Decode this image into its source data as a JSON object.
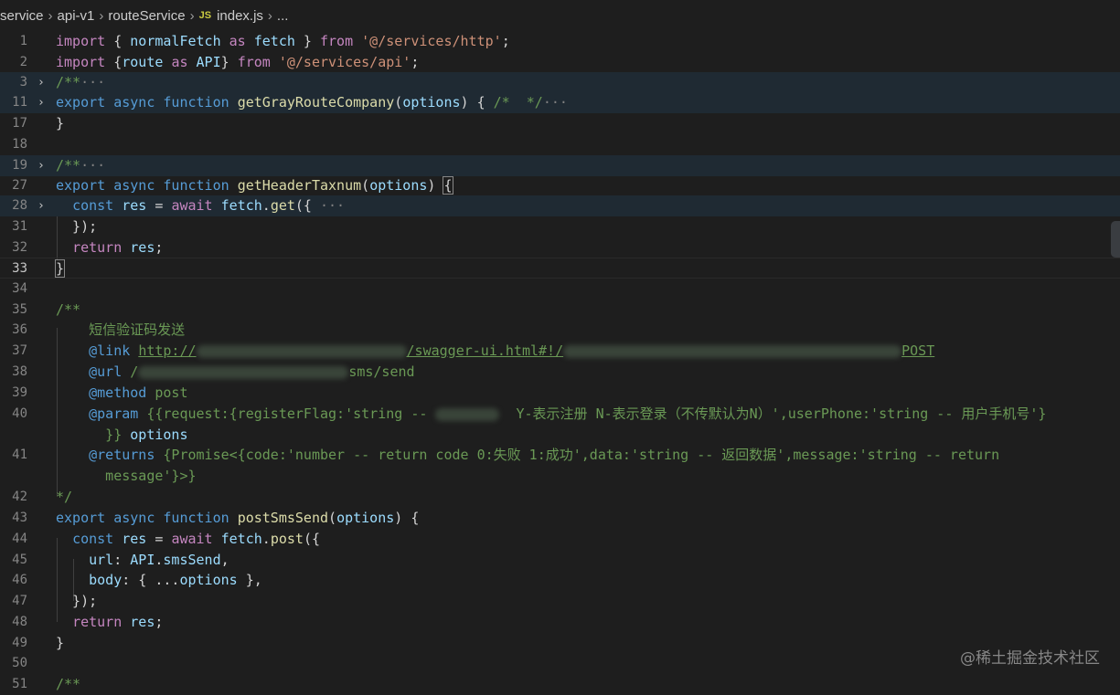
{
  "breadcrumb": {
    "items": [
      "service",
      "api-v1",
      "routeService"
    ],
    "js_badge": "JS",
    "file": "index.js",
    "more": "..."
  },
  "lines": {
    "l1": {
      "num": "1",
      "text": "import { normalFetch as fetch } from '@/services/http';"
    },
    "l2": {
      "num": "2",
      "text": "import {route as API} from '@/services/api';"
    },
    "l3": {
      "num": "3",
      "text": "/**···"
    },
    "l11": {
      "num": "11",
      "text": "export async function getGrayRouteCompany(options) { /*  */···"
    },
    "l17": {
      "num": "17",
      "text": "}"
    },
    "l18": {
      "num": "18",
      "text": ""
    },
    "l19": {
      "num": "19",
      "text": "/**···"
    },
    "l27": {
      "num": "27",
      "text": "export async function getHeaderTaxnum(options) {"
    },
    "l28": {
      "num": "28",
      "text": "const res = await fetch.get({ ···"
    },
    "l31": {
      "num": "31",
      "text": "});"
    },
    "l32": {
      "num": "32",
      "text": "return res;"
    },
    "l33": {
      "num": "33",
      "text": "}"
    },
    "l34": {
      "num": "34",
      "text": ""
    },
    "l35": {
      "num": "35",
      "text": "/**"
    },
    "l36": {
      "num": "36",
      "text": "短信验证码发送"
    },
    "l37": {
      "num": "37",
      "text": "@link http://"
    },
    "l38": {
      "num": "38",
      "text": "@url /"
    },
    "l39": {
      "num": "39",
      "text": "@method post"
    },
    "l40": {
      "num": "40",
      "text": "@param {{request:{registerFlag:'string -- Y-表示注册 N-表示登录（不传默认为N）',userPhone:'string -- 用户手机号'}}} options"
    },
    "l41": {
      "num": "41",
      "text": "@returns {Promise<{code:'number -- return code 0:失败 1:成功',data:'string -- 返回数据',message:'string -- return message'}>}"
    },
    "l42": {
      "num": "42",
      "text": "*/"
    },
    "l43": {
      "num": "43",
      "text": "export async function postSmsSend(options) {"
    },
    "l44": {
      "num": "44",
      "text": "const res = await fetch.post({"
    },
    "l45": {
      "num": "45",
      "text": "url: API.smsSend,"
    },
    "l46": {
      "num": "46",
      "text": "body: { ...options },"
    },
    "l47": {
      "num": "47",
      "text": "});"
    },
    "l48": {
      "num": "48",
      "text": "return res;"
    },
    "l49": {
      "num": "49",
      "text": "}"
    },
    "l50": {
      "num": "50",
      "text": ""
    },
    "l51": {
      "num": "51",
      "text": "/**"
    }
  },
  "link_parts": {
    "visible_mid": "/swagger-ui.html#!/",
    "visible_end": "POST"
  },
  "url_parts": {
    "visible_end": "sms/send"
  },
  "watermark": "@稀土掘金技术社区",
  "colors": {
    "background": "#1e1e1e",
    "keyword": "#569cd6",
    "control": "#c586c0",
    "function": "#dcdcaa",
    "variable": "#9cdcfe",
    "string": "#ce9178",
    "comment": "#6a9955"
  }
}
